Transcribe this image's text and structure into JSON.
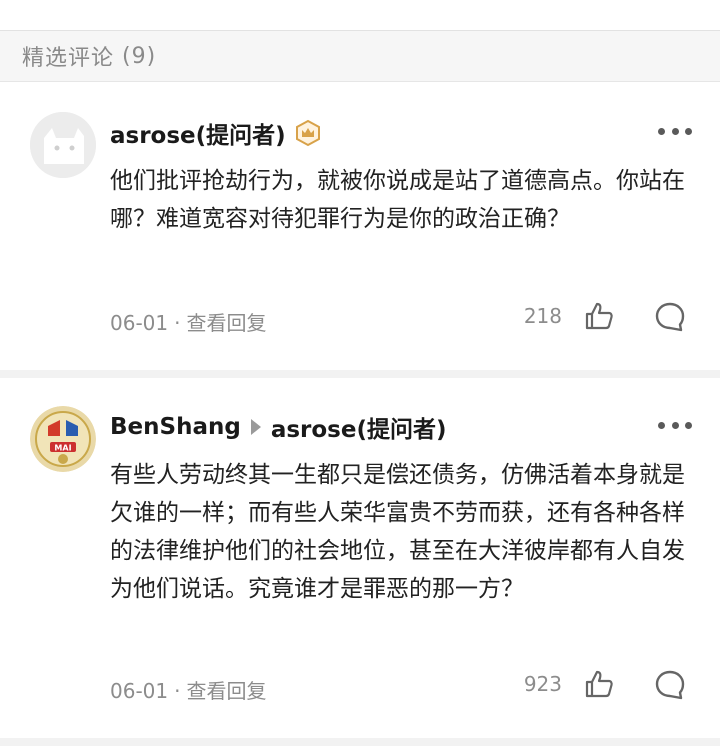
{
  "header": {
    "title": "精选评论",
    "count": "(9)"
  },
  "comments": [
    {
      "author": "asrose(提问者)",
      "author_badge_icon": "crown-badge-icon",
      "text": "他们批评抢劫行为，就被你说成是站了道德高点。你站在哪？难道宽容对待犯罪行为是你的政治正确？",
      "date": "06-01",
      "separator": "·",
      "view_replies": "查看回复",
      "likes": "218"
    },
    {
      "author": "BenShang",
      "reply_to": "asrose(提问者)",
      "avatar_text": "MAI",
      "text": "有些人劳动终其一生都只是偿还债务，仿佛活着本身就是欠谁的一样；而有些人荣华富贵不劳而获，还有各种各样的法律维护他们的社会地位，甚至在大洋彼岸都有人自发为他们说话。究竟谁才是罪恶的那一方？",
      "date": "06-01",
      "separator": "·",
      "view_replies": "查看回复",
      "likes": "923"
    }
  ],
  "colors": {
    "badge": "#d8a24a",
    "accent_text": "#1a1a1a",
    "meta": "#8c8c8c"
  }
}
